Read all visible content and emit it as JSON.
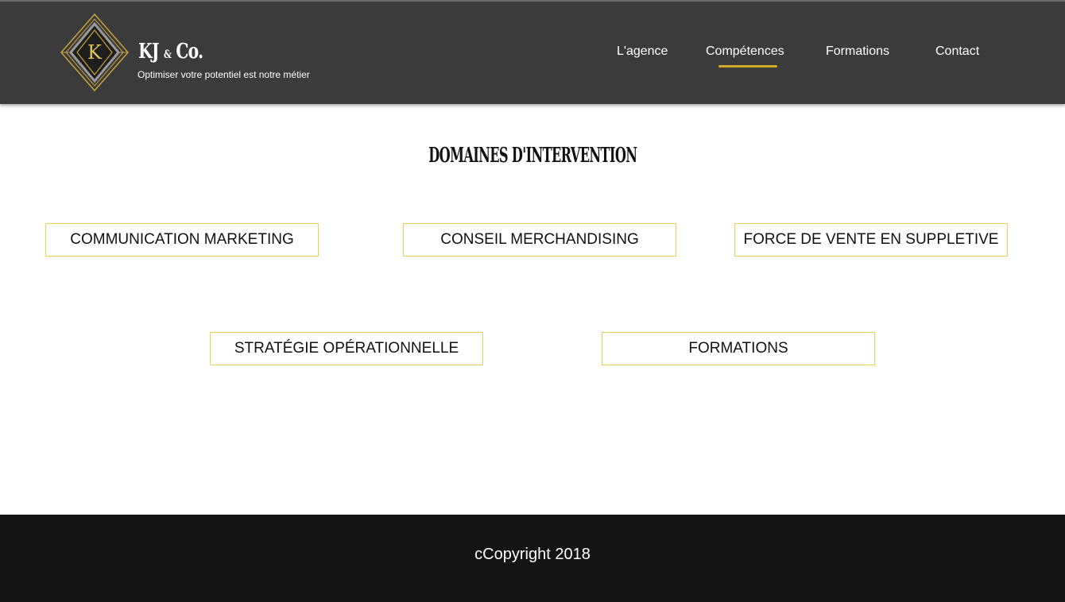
{
  "header": {
    "logo_letter": "K",
    "brand_main": "KJ",
    "brand_amp": "&",
    "brand_tail": "Co.",
    "tagline": "Optimiser votre potentiel est notre métier",
    "nav": [
      {
        "label": "L'agence",
        "active": false
      },
      {
        "label": "Compétences",
        "active": true
      },
      {
        "label": "Formations",
        "active": false
      },
      {
        "label": "Contact",
        "active": false
      }
    ]
  },
  "main": {
    "title": "DOMAINES D'INTERVENTION",
    "domains": [
      "COMMUNICATION MARKETING",
      "CONSEIL MERCHANDISING",
      "FORCE DE VENTE EN SUPPLETIVE",
      "STRATÉGIE OPÉRATIONNELLE",
      "FORMATIONS"
    ]
  },
  "footer": {
    "copyright": "cCopyright 2018"
  },
  "colors": {
    "header_bg": "#3b3b3b",
    "accent_gold": "#d4aa2a",
    "box_border": "#e8cf55",
    "footer_bg": "#141414"
  }
}
